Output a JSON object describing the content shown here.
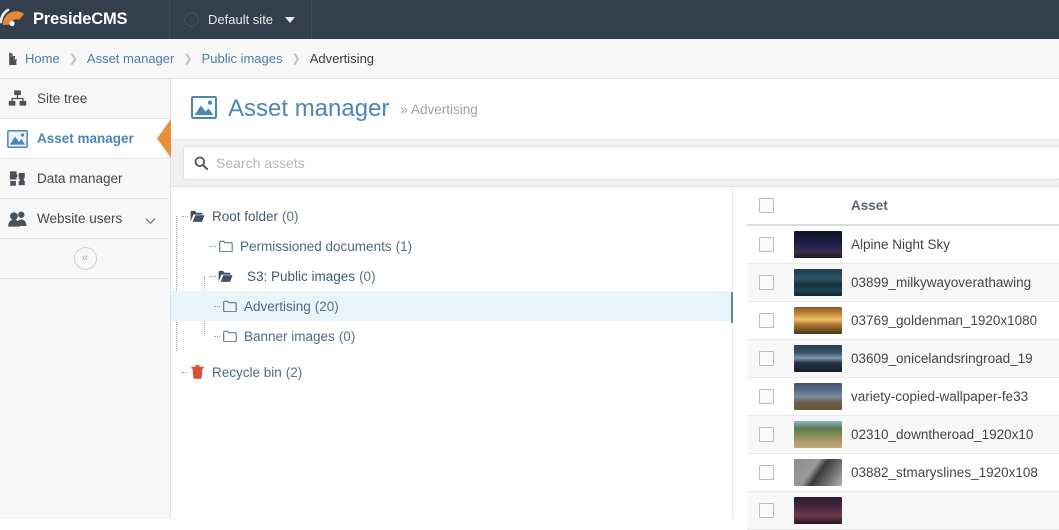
{
  "topbar": {
    "brand_primary": "Preside",
    "brand_secondary": "CMS",
    "site_label": "Default site",
    "brand_bg": "#343f4e",
    "logo_color": "#e8873a"
  },
  "breadcrumb": {
    "items": [
      {
        "label": "Home",
        "active": false
      },
      {
        "label": "Asset manager",
        "active": false
      },
      {
        "label": "Public images",
        "active": false
      },
      {
        "label": "Advertising",
        "active": true
      }
    ],
    "separator": "❯"
  },
  "sidebar": {
    "items": [
      {
        "label": "Site tree",
        "icon": "site-tree-icon",
        "active": false,
        "chevron": false
      },
      {
        "label": "Asset manager",
        "icon": "asset-manager-icon",
        "active": true,
        "chevron": false
      },
      {
        "label": "Data manager",
        "icon": "data-manager-icon",
        "active": false,
        "chevron": false
      },
      {
        "label": "Website users",
        "icon": "website-users-icon",
        "active": false,
        "chevron": true
      }
    ],
    "collapse_glyph": "«",
    "active_marker_color": "#e8913c"
  },
  "page": {
    "title": "Asset manager",
    "subtitle_chevron": "»",
    "subtitle": "Advertising",
    "title_color": "#4a87b5"
  },
  "search": {
    "placeholder": "Search assets",
    "value": ""
  },
  "tree": {
    "nodes": [
      {
        "label": "Root folder",
        "count": "(0)",
        "icon": "folder-open-icon",
        "depth": 0,
        "selected": false
      },
      {
        "label": "Permissioned documents",
        "count": "(1)",
        "icon": "folder-closed-icon",
        "depth": 1,
        "selected": false
      },
      {
        "label": "S3: Public images",
        "count": "(0)",
        "icon": "folder-open-icon",
        "depth": 1,
        "selected": false
      },
      {
        "label": "Advertising",
        "count": "(20)",
        "icon": "folder-closed-icon",
        "depth": 2,
        "selected": true
      },
      {
        "label": "Banner images",
        "count": "(0)",
        "icon": "folder-closed-icon",
        "depth": 2,
        "selected": false
      },
      {
        "label": "Recycle bin",
        "count": "(2)",
        "icon": "trash-icon",
        "depth": 0,
        "selected": false
      }
    ],
    "selected_bg": "#e9f3fa"
  },
  "assets": {
    "column_header": "Asset",
    "rows": [
      {
        "name": "Alpine Night Sky",
        "thumb": "night-sky-thumb"
      },
      {
        "name": "03899_milkywayoverathawing",
        "thumb": "milky-way-thumb"
      },
      {
        "name": "03769_goldenman_1920x1080",
        "thumb": "golden-sunset-thumb"
      },
      {
        "name": "03609_onicelandsringroad_19",
        "thumb": "ring-road-thumb"
      },
      {
        "name": "variety-copied-wallpaper-fe33",
        "thumb": "mountains-thumb"
      },
      {
        "name": "02310_downtheroad_1920x10",
        "thumb": "country-road-thumb"
      },
      {
        "name": "03882_stmaryslines_1920x108",
        "thumb": "grayscale-lines-thumb"
      },
      {
        "name": "",
        "thumb": "purple-dusk-thumb"
      }
    ]
  }
}
